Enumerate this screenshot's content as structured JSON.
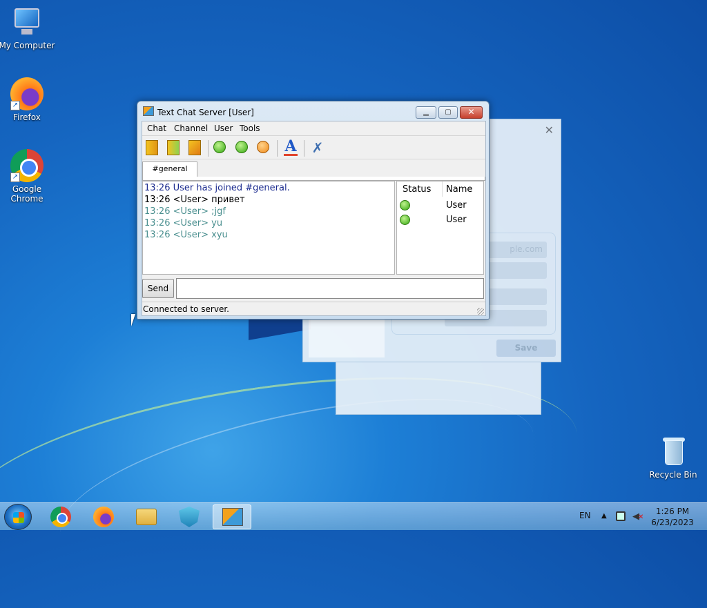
{
  "desktop": {
    "icons": [
      {
        "label": "My Computer"
      },
      {
        "label": "Firefox"
      },
      {
        "label": "Google Chrome"
      },
      {
        "label": "Recycle Bin"
      }
    ]
  },
  "background_dialog": {
    "email_placeholder_partial": "ple.com",
    "save_label": "Save",
    "close_glyph": "✕"
  },
  "window": {
    "title": "Text Chat Server [User]",
    "controls": {
      "minimize": "▁",
      "maximize": "▢",
      "close": "✕"
    },
    "menu": [
      "Chat",
      "Channel",
      "User",
      "Tools"
    ],
    "toolbar_icons": [
      "join-channel-icon",
      "channel-list-icon",
      "leave-channel-icon",
      "user-info-icon",
      "whois-icon",
      "away-icon",
      "font-icon",
      "settings-tools-icon"
    ],
    "tabs": [
      {
        "label": "#general",
        "active": true
      }
    ],
    "messages": [
      {
        "text": "13:26 User has joined #general.",
        "kind": "system"
      },
      {
        "text": "13:26 <User> привет",
        "kind": "own"
      },
      {
        "text": "13:26 <User> ;jgf",
        "kind": "history"
      },
      {
        "text": "13:26 <User> yu",
        "kind": "history"
      },
      {
        "text": "13:26 <User> xyu",
        "kind": "history"
      }
    ],
    "userlist": {
      "columns": [
        "Status",
        "Name"
      ],
      "users": [
        {
          "status_icon": "online-smiley-icon",
          "name": "User"
        },
        {
          "status_icon": "online-smiley-icon",
          "name": "User"
        }
      ]
    },
    "send_label": "Send",
    "input_value": "",
    "status_text": "Connected to server."
  },
  "taskbar": {
    "apps": [
      "chrome",
      "firefox",
      "file-explorer",
      "vpn-shield",
      "text-chat-server"
    ],
    "active_app": "text-chat-server",
    "language": "EN",
    "time": "1:26 PM",
    "date": "6/23/2023"
  },
  "colors": {
    "system_message": "#1b2b8f",
    "history_message": "#4a8f8f",
    "online_status": "#35a811"
  }
}
